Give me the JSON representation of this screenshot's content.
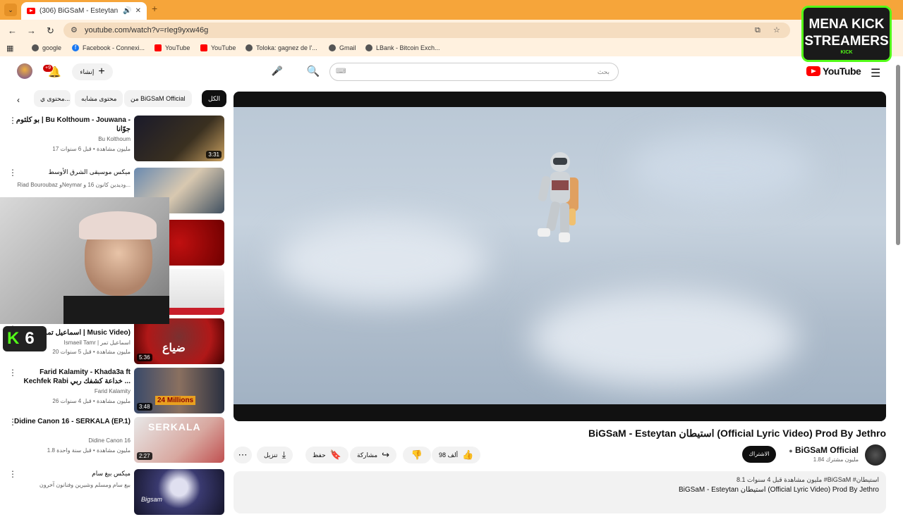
{
  "browser": {
    "tab_title": "(306) BiGSaM - Esteytan استيطان",
    "tab_audio_icon": "speaker-icon",
    "tab_close": "✕",
    "new_tab": "+",
    "url": "youtube.com/watch?v=rIeg9yxw46g",
    "bookmarks": [
      "google",
      "Facebook - Connexi...",
      "YouTube",
      "YouTube",
      "Toloka: gagnez de l'...",
      "Gmail",
      "LBank - Bitcoin Exch..."
    ]
  },
  "header": {
    "logo_text": "YouTube",
    "search_placeholder": "بحث",
    "create_label": "إنشاء",
    "notif_badge": "+9"
  },
  "chips": [
    "الكل",
    "من BiGSaM Official",
    "محتوى مشابه",
    "محتوى ي..."
  ],
  "recommendations": [
    {
      "title": "بو كلثوم | Bu Kolthoum - Jouwana - جوّانا",
      "channel": "Bu Kolthoum",
      "meta": "17 مليون مشاهدة • قبل 6 سنوات",
      "duration": "3:31"
    },
    {
      "title": "ميكس موسيقى الشرق الأوسط",
      "channel": "Riad Bouroubaz وNeymar وديدين كانون 16 و...",
      "meta": "",
      "duration": ""
    },
    {
      "title": "",
      "channel": "",
      "meta": "",
      "duration": ""
    },
    {
      "title": "",
      "channel": "",
      "meta": "",
      "duration": ""
    },
    {
      "title": "اسماعيل تمر - ضياع | Music Video)",
      "channel": "Ismaeil Tamr | اسماعيل تمر",
      "meta": "20 مليون مشاهدة • قبل 5 سنوات",
      "duration": "5:36"
    },
    {
      "title": "Farid Kalamity - Khada3a ft Kechfek Rabi خداعة كشفك ربي ...",
      "channel": "Farid Kalamity",
      "meta": "26 مليون مشاهدة • قبل 4 سنوات",
      "duration": "3:48"
    },
    {
      "title": "Didine Canon 16 - SERKALA (EP.1)",
      "channel": "Didine Canon 16",
      "meta": "1.8 مليون مشاهدة • قبل سنة واحدة",
      "duration": "2:27"
    },
    {
      "title": "ميكس بيغ سام",
      "channel": "بيغ سام ومسلم وشيرين وفنانون آخرون",
      "meta": "",
      "duration": ""
    }
  ],
  "thumb_texts": {
    "r5": "ضياع",
    "r6": "24 Millions",
    "r7": "SERKALA",
    "r8": "Bigsam"
  },
  "video": {
    "title": "BiGSaM - Esteytan استيطان (Official Lyric Video) Prod By Jethro",
    "channel": "BiGSaM Official",
    "subs": "1.84 مليون مشترك",
    "subscribe": "الاشتراك",
    "likes": "98 ألف",
    "share": "مشاركة",
    "save": "حفظ",
    "download": "تنزيل",
    "desc_line1": "8.1 مليون مشاهدة قبل 4 سنوات #BiGSaM #استيطان",
    "desc_line2": "BiGSaM - Esteytan استيطان (Official Lyric Video) Prod By Jethro"
  },
  "overlays": {
    "kick_count": "6",
    "brand_line1": "MENA KICK",
    "brand_line2": "STREAMERS",
    "brand_tag": "KICK"
  }
}
